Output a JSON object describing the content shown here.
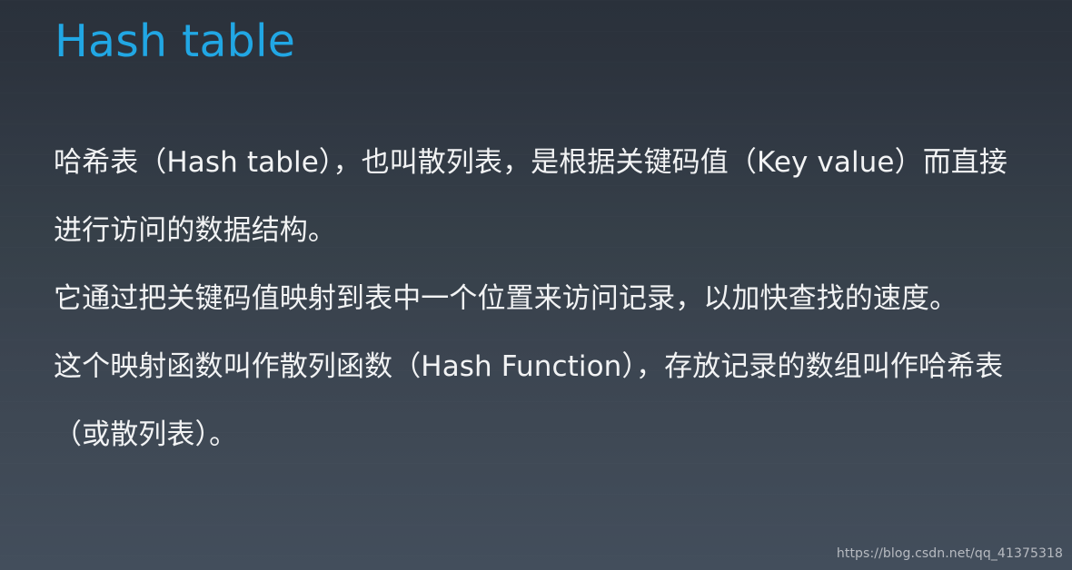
{
  "slide": {
    "title": "Hash table",
    "title_color": "#21a7e4",
    "background_top_color": "#2a313b",
    "background_bottom_color": "#434e5c",
    "body_text_color": "#f2f3f4",
    "paragraphs": [
      "哈希表（Hash table），也叫散列表，是根据关键码值（Key value）而直接进行访问的数据结构。",
      "它通过把关键码值映射到表中一个位置来访问记录，以加快查找的速度。",
      "这个映射函数叫作散列函数（Hash Function），存放记录的数组叫作哈希表（或散列表）。"
    ],
    "watermark": {
      "text": "https://blog.csdn.net/qq_41375318",
      "color": "#b7bbc1"
    }
  }
}
